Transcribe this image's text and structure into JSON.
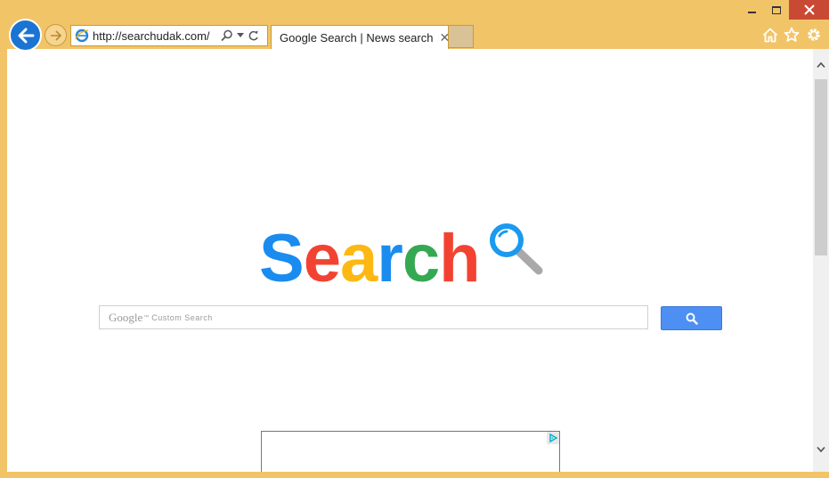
{
  "window": {
    "controls": {
      "minimize_icon": "minimize-icon",
      "maximize_icon": "maximize-icon",
      "close_icon": "close-x-icon"
    }
  },
  "navigation": {
    "back_icon": "arrow-left-icon",
    "forward_icon": "arrow-right-icon"
  },
  "address_bar": {
    "url": "http://searchudak.com/",
    "site_icon": "ie-logo-icon",
    "search_icon": "search-icon",
    "dropdown_icon": "chevron-down-icon",
    "refresh_icon": "refresh-icon"
  },
  "tabs": [
    {
      "label": "Google Search | News search",
      "active": true,
      "icon": "ie-logo-icon",
      "close_glyph": "✕"
    }
  ],
  "toolbar": {
    "home_icon": "home-icon",
    "favorites_icon": "star-icon",
    "settings_icon": "gear-icon"
  },
  "page": {
    "logo": {
      "letters": [
        "S",
        "e",
        "a",
        "r",
        "c",
        "h"
      ],
      "colors": [
        "#1a8cf0",
        "#f24332",
        "#fdb813",
        "#1a8cf0",
        "#35a853",
        "#f24332"
      ],
      "magnifier_ring_color": "#1a9af0",
      "magnifier_handle_color": "#a9a9a9"
    },
    "search": {
      "watermark_brand": "Google",
      "watermark_tm": "™",
      "watermark_text": "Custom Search",
      "button_icon": "search-icon",
      "button_color": "#4d8ff2"
    },
    "ad": {
      "choices_icon": "adchoices-icon"
    }
  },
  "colors": {
    "frame": "#f2c468",
    "accent_blue": "#1b73d4",
    "close_red": "#c94a34"
  }
}
